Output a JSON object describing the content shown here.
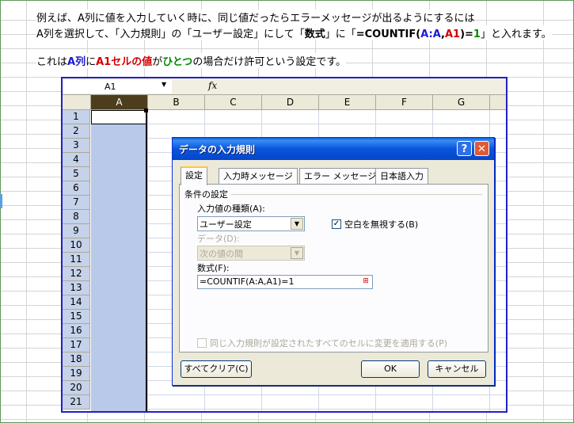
{
  "instructions": {
    "line1": "例えば、A列に値を入力していく時に、同じ値だったらエラーメッセージが出るようにするには",
    "line2_a": "A列を選択して、「入力規則」の「ユーザー設定」にして「",
    "line2_b": "数式",
    "line2_c": "」に「",
    "line2_d": "=COUNTIF(",
    "line2_e": "A:A",
    "line2_f": ",",
    "line2_g": "A1",
    "line2_h": ")=",
    "line2_i": "1",
    "line2_j": "」と入れます。",
    "line3_a": "これは",
    "line3_b": "A列",
    "line3_c": "に",
    "line3_d": "A1セルの値",
    "line3_e": "が",
    "line3_f": "ひとつ",
    "line3_g": "の場合だけ許可という設定です。"
  },
  "spreadsheet": {
    "namebox": "A1",
    "fx": "fx",
    "columns": [
      "A",
      "B",
      "C",
      "D",
      "E",
      "F",
      "G"
    ],
    "rows": [
      "1",
      "2",
      "3",
      "4",
      "5",
      "6",
      "7",
      "8",
      "9",
      "10",
      "11",
      "12",
      "13",
      "14",
      "15",
      "16",
      "17",
      "18",
      "19",
      "20",
      "21"
    ]
  },
  "dialog": {
    "title": "データの入力規則",
    "help": "?",
    "close": "✕",
    "tabs": [
      "設定",
      "入力時メッセージ",
      "エラー メッセージ",
      "日本語入力"
    ],
    "group_label": "条件の設定",
    "allow_label": "入力値の種類(A):",
    "allow_value": "ユーザー設定",
    "ignore_blank_label": "空白を無視する(B)",
    "ignore_blank_checked": "✓",
    "data_label": "データ(D):",
    "data_value": "次の値の間",
    "formula_label": "数式(F):",
    "formula_value": "=COUNTIF(A:A,A1)=1",
    "apply_all_label": "同じ入力規則が設定されたすべてのセルに変更を適用する(P)",
    "clear_all": "すべてクリア(C)",
    "ok": "OK",
    "cancel": "キャンセル"
  },
  "colors": {
    "dialog_title": "#0855dd",
    "selected_column": "#b9c9e9",
    "frame_border": "#2020c8"
  }
}
